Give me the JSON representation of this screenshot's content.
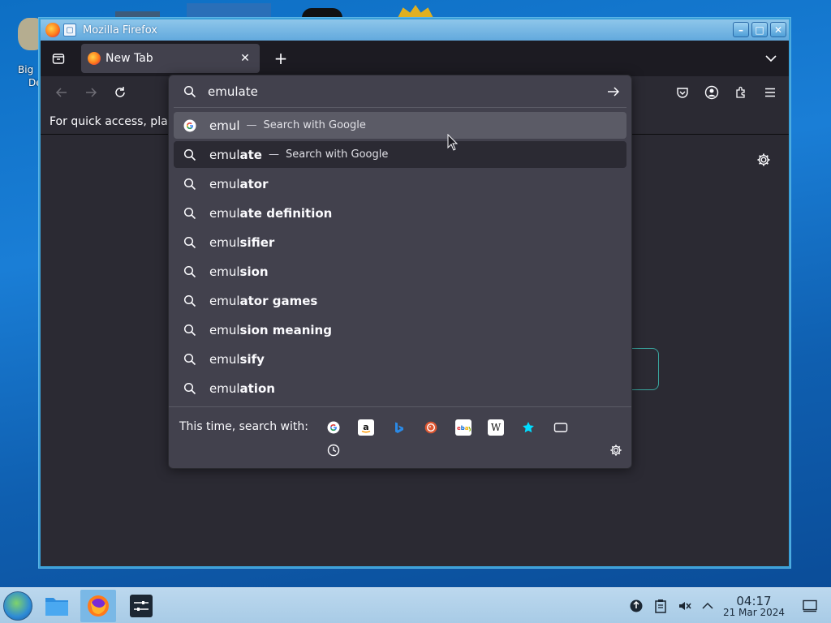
{
  "desktop": {
    "icon_label_line1": "Big",
    "icon_label_line2": "De"
  },
  "window": {
    "title": "Mozilla Firefox"
  },
  "tabs": [
    {
      "label": "New Tab"
    }
  ],
  "bookmarks_bar": {
    "text": "For quick access, plac"
  },
  "urlbar": {
    "value": "emulate",
    "results": [
      {
        "prefix": "emul",
        "suffix": "",
        "action": "Search with Google",
        "icon": "google-icon",
        "state": "hover"
      },
      {
        "prefix": "emul",
        "suffix": "ate",
        "action": "Search with Google",
        "icon": "search-icon",
        "state": "selected"
      },
      {
        "prefix": "emul",
        "suffix": "ator",
        "action": "",
        "icon": "search-icon"
      },
      {
        "prefix": "emul",
        "suffix": "ate definition",
        "action": "",
        "icon": "search-icon"
      },
      {
        "prefix": "emul",
        "suffix": "sifier",
        "action": "",
        "icon": "search-icon"
      },
      {
        "prefix": "emul",
        "suffix": "sion",
        "action": "",
        "icon": "search-icon"
      },
      {
        "prefix": "emul",
        "suffix": "ator games",
        "action": "",
        "icon": "search-icon"
      },
      {
        "prefix": "emul",
        "suffix": "sion meaning",
        "action": "",
        "icon": "search-icon"
      },
      {
        "prefix": "emul",
        "suffix": "sify",
        "action": "",
        "icon": "search-icon"
      },
      {
        "prefix": "emul",
        "suffix": "ation",
        "action": "",
        "icon": "search-icon"
      }
    ],
    "separator": "—",
    "oneoff_label": "This time, search with:",
    "engines": [
      "google-icon",
      "amazon-icon",
      "bing-icon",
      "duckduckgo-icon",
      "ebay-icon",
      "wikipedia-icon",
      "bookmarks-star-icon",
      "tabs-icon",
      "history-icon"
    ]
  },
  "taskbar": {
    "time": "04:17",
    "date": "21 Mar 2024"
  },
  "colors": {
    "accent": "#3aa0d8",
    "toolbar": "#2b2a33",
    "popup": "#42414d"
  }
}
